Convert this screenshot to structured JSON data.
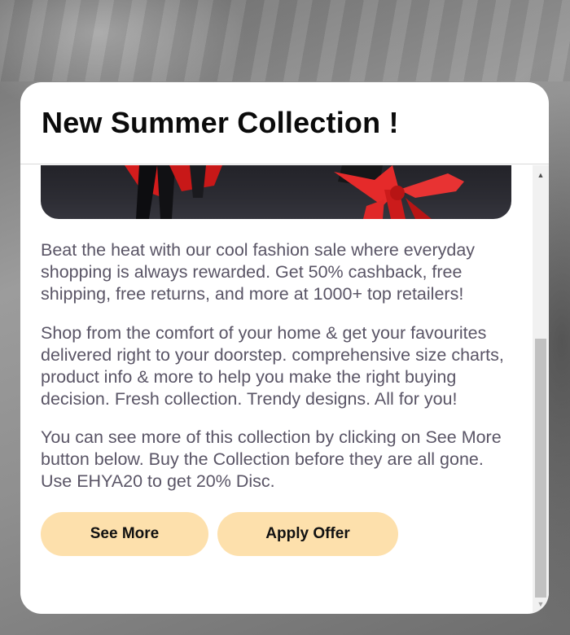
{
  "modal": {
    "title": "New Summer Collection !",
    "paragraphs": [
      "Beat the heat with our cool fashion sale where everyday shopping is always rewarded. Get 50% cashback, free shipping, free returns, and more at 1000+ top retailers!",
      "Shop from the comfort of your home & get your favourites delivered right to your doorstep. comprehensive size charts, product info & more to help you make the right buying decision. Fresh collection. Trendy designs. All for you!",
      "You can see more of this collection by clicking on See More button below. Buy the Collection before they are all gone. Use EHYA20 to get 20% Disc."
    ],
    "buttons": {
      "see_more": "See More",
      "apply_offer": "Apply Offer"
    }
  },
  "scrollbar": {
    "up_icon": "scroll-up-arrow",
    "down_icon": "scroll-down-arrow"
  },
  "colors": {
    "button_bg": "#fde0ac",
    "body_text": "#5a5566",
    "title_text": "#0b0b0b",
    "ribbon_red": "#e02020"
  }
}
